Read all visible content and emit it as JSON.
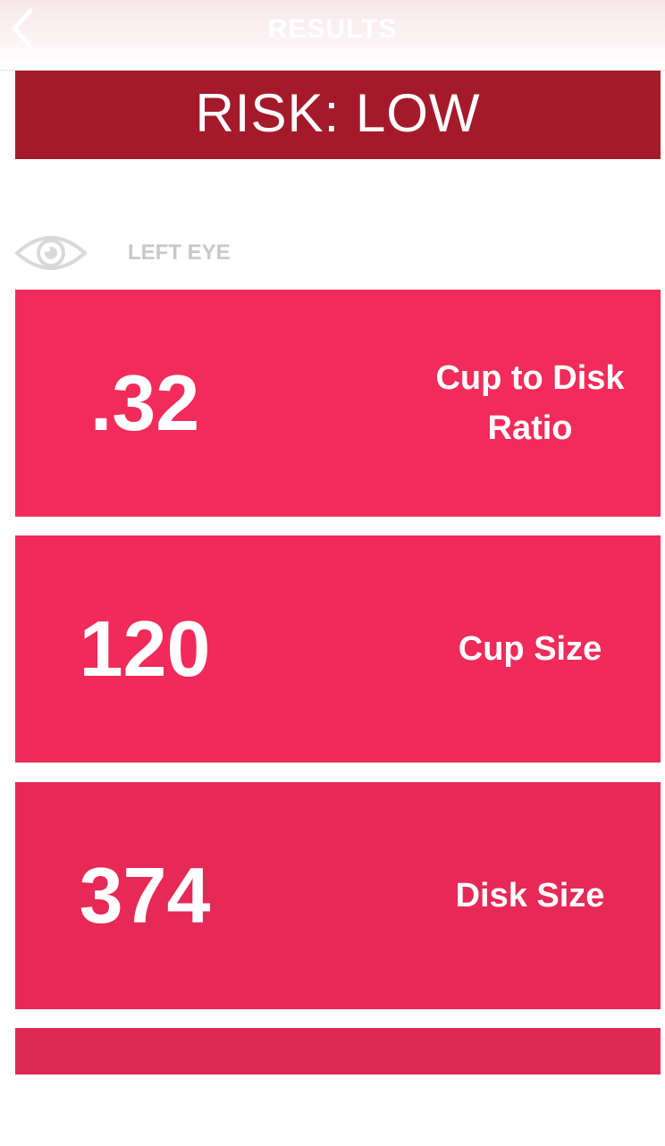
{
  "nav": {
    "title": "RESULTS",
    "back_icon": "chevron-left-icon"
  },
  "risk": {
    "text": "RISK: LOW",
    "color": "#a51a2b"
  },
  "eye_section": {
    "icon": "eye-icon",
    "label": "LEFT EYE"
  },
  "metrics": [
    {
      "value": ".32",
      "label": "Cup to Disk Ratio",
      "color": "#f22c5a"
    },
    {
      "value": "120",
      "label": "Cup Size",
      "color": "#f02a59"
    },
    {
      "value": "374",
      "label": "Disk Size",
      "color": "#e62957"
    }
  ],
  "partial_card": {
    "color": "#de2955"
  }
}
